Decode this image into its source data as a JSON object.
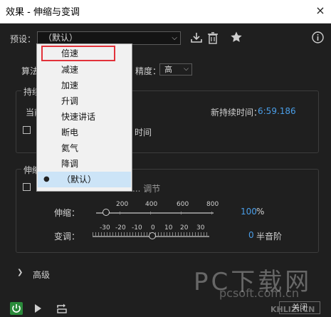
{
  "window": {
    "title": "效果 - 伸缩与变调",
    "close": "×"
  },
  "preset": {
    "label": "预设：",
    "value": "（默认）"
  },
  "dropdown": {
    "items": [
      {
        "label": "倍速"
      },
      {
        "label": "减速"
      },
      {
        "label": "加速"
      },
      {
        "label": "升调"
      },
      {
        "label": "快速讲话"
      },
      {
        "label": "断电"
      },
      {
        "label": "氦气"
      },
      {
        "label": "降调"
      },
      {
        "label": "（默认）"
      }
    ],
    "highlighted": "倍速",
    "selected": "（默认）"
  },
  "algorithm": {
    "label": "算法"
  },
  "quality": {
    "label": "精度：",
    "value": "高"
  },
  "duration": {
    "section": "持续",
    "current_label": "当前",
    "new_label": "新持续时间：",
    "new_value": "6:59.186",
    "lock_suffix": "时间"
  },
  "stretch_section": {
    "title": "伸缩",
    "checkbox_suffix": "... 调节"
  },
  "stretch": {
    "label": "伸缩：",
    "value": "100",
    "unit": "%",
    "ticks": [
      "200",
      "400",
      "600",
      "800"
    ]
  },
  "pitch": {
    "label": "变调：",
    "value": "0",
    "unit": "半音阶",
    "ticks": [
      "-30",
      "-20",
      "-10",
      "0",
      "10",
      "20",
      "30"
    ]
  },
  "advanced": {
    "label": "高级"
  },
  "bottom": {
    "close_label": "关闭"
  },
  "watermark": {
    "line1": "PC下载网",
    "line2": "pcsoft.com.cn",
    "brand": "KHLIZI.CN"
  }
}
